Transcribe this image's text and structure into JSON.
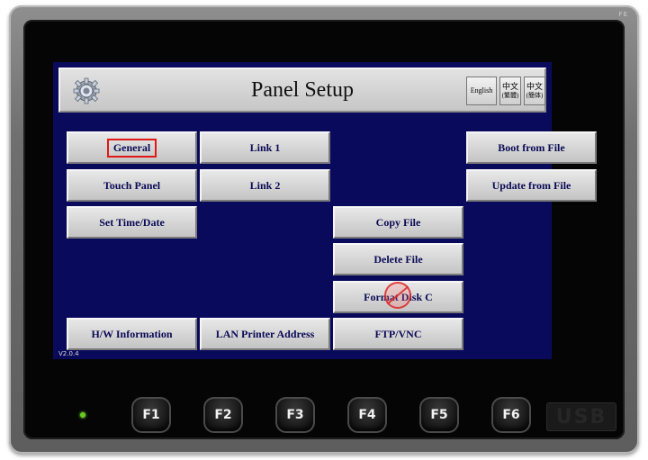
{
  "panel": {
    "title": "Panel Setup",
    "version": "V2.0.4",
    "brand_mark": "FE"
  },
  "language": {
    "english": "English",
    "traditional_line1": "中文",
    "traditional_line2": "(繁體)",
    "simplified_line1": "中文",
    "simplified_line2": "(簡体)"
  },
  "buttons": {
    "general": "General",
    "touch_panel": "Touch Panel",
    "set_time_date": "Set Time/Date",
    "hw_information": "H/W Information",
    "link1": "Link 1",
    "link2": "Link 2",
    "lan_printer": "LAN Printer Address",
    "copy_file": "Copy File",
    "delete_file": "Delete File",
    "format_disk": "Format Disk C",
    "ftp_vnc": "FTP/VNC",
    "boot_from_file": "Boot from File",
    "update_from_file": "Update from File"
  },
  "fkeys": [
    "F1",
    "F2",
    "F3",
    "F4",
    "F5",
    "F6"
  ],
  "usb_label": "USB",
  "colors": {
    "screen_bg": "#0a0a5c",
    "button_text": "#0a0a55",
    "selection_outline": "#e01818",
    "led": "#66cc22"
  },
  "icons": {
    "settings": "gear-icon",
    "touch_indicator": "touch-point-icon"
  }
}
